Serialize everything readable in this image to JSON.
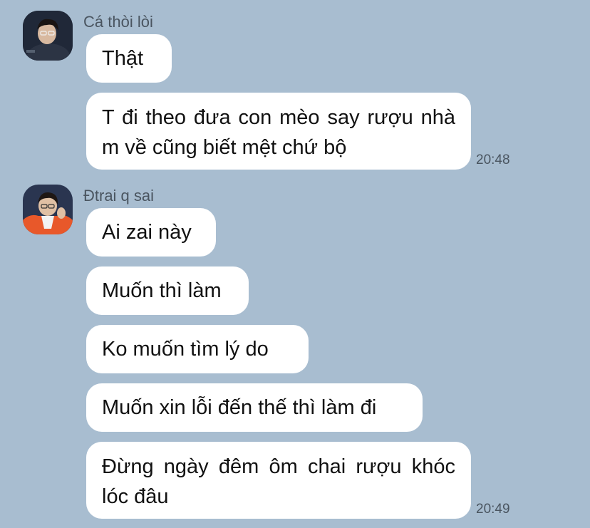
{
  "messages_group_1": {
    "sender": "Cá thòi lòi",
    "avatar_icon": "user-avatar-icon",
    "bubbles": [
      "Thật",
      "T đi theo đưa con mèo say rượu nhà m về cũng biết mệt chứ bộ"
    ],
    "time": "20:48"
  },
  "messages_group_2": {
    "sender": "Đtrai q sai",
    "avatar_icon": "user-avatar-icon",
    "bubbles": [
      "Ai zai này",
      "Muốn thì làm",
      "Ko muốn tìm lý do",
      "Muốn xin lỗi đến thế thì làm đi",
      "Đừng ngày đêm ôm chai rượu khóc lóc đâu"
    ],
    "time": "20:49"
  },
  "colors": {
    "background": "#a8bdd0",
    "bubble": "#ffffff",
    "meta_text": "#4a5560"
  }
}
